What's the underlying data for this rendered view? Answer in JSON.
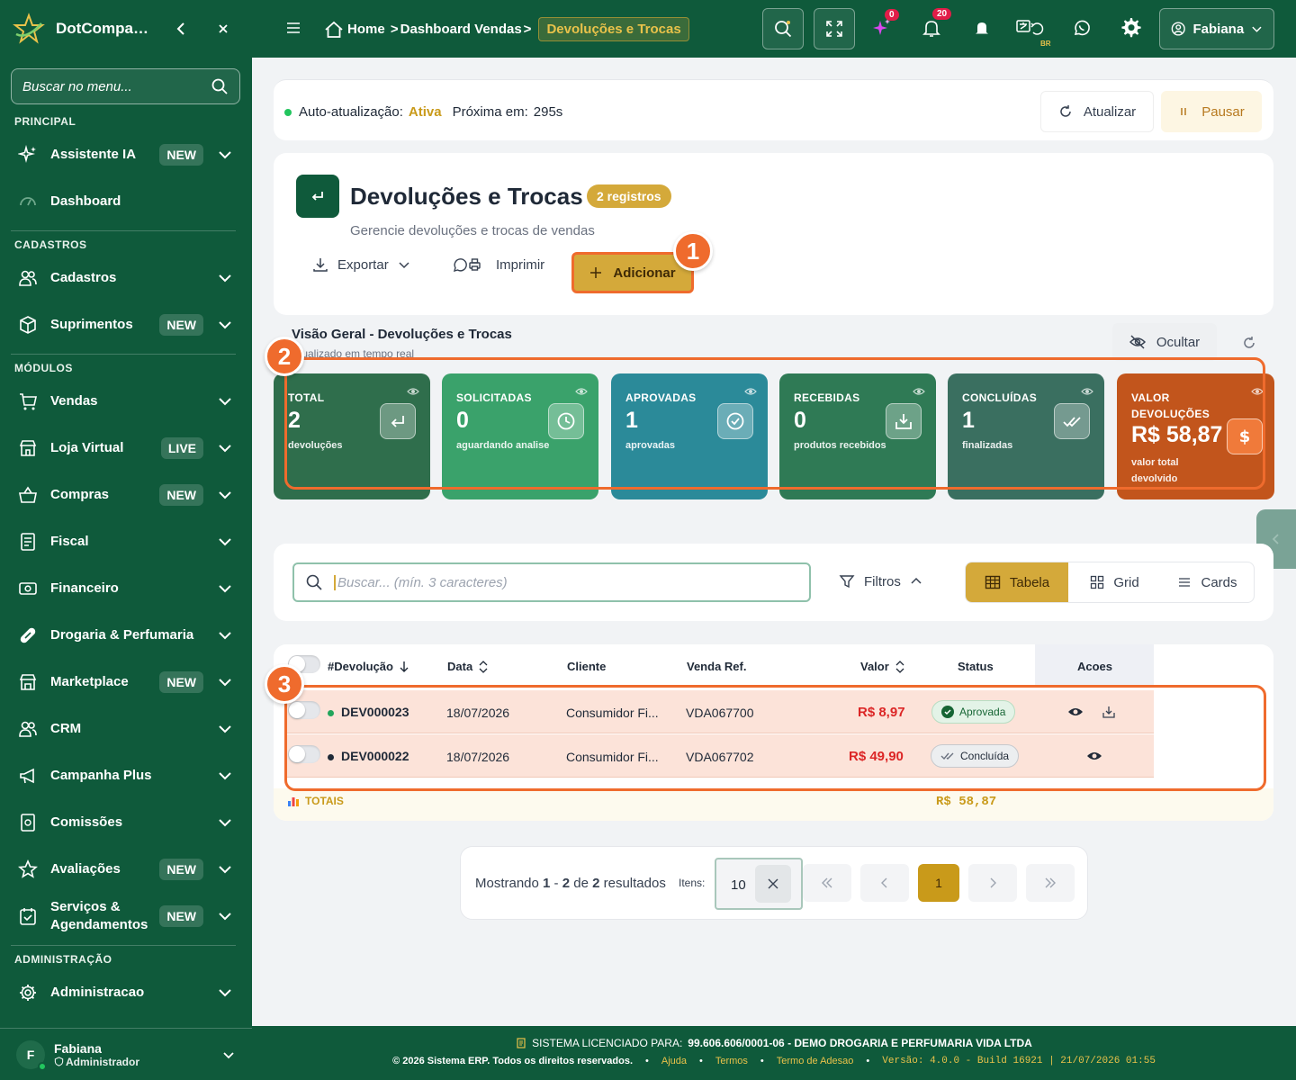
{
  "sidebar": {
    "brand": "DotCompanion",
    "search_placeholder": "Buscar no menu...",
    "sections": {
      "principal": "PRINCIPAL",
      "cadastros": "CADASTROS",
      "modulos": "MÓDULOS",
      "administracao": "ADMINISTRAÇÃO"
    },
    "items": [
      {
        "label": "Assistente IA",
        "badge": "NEW"
      },
      {
        "label": "Dashboard",
        "badge": ""
      },
      {
        "label": "Cadastros",
        "badge": ""
      },
      {
        "label": "Suprimentos",
        "badge": "NEW"
      },
      {
        "label": "Vendas",
        "badge": ""
      },
      {
        "label": "Loja Virtual",
        "badge": "LIVE"
      },
      {
        "label": "Compras",
        "badge": "NEW"
      },
      {
        "label": "Fiscal",
        "badge": ""
      },
      {
        "label": "Financeiro",
        "badge": ""
      },
      {
        "label": "Drogaria & Perfumaria",
        "badge": ""
      },
      {
        "label": "Marketplace",
        "badge": "NEW"
      },
      {
        "label": "CRM",
        "badge": ""
      },
      {
        "label": "Campanha Plus",
        "badge": ""
      },
      {
        "label": "Comissões",
        "badge": ""
      },
      {
        "label": "Avaliações",
        "badge": "NEW"
      },
      {
        "label": "Serviços & Agendamentos",
        "badge": "NEW"
      },
      {
        "label": "Administracao",
        "badge": ""
      }
    ],
    "user": {
      "initial": "F",
      "name": "Fabiana",
      "role": "Administrador"
    }
  },
  "topbar": {
    "breadcrumb": [
      "Home",
      "Dashboard Vendas",
      "Devoluções e Trocas"
    ],
    "ai_count": "0",
    "notif_count": "20",
    "locale": "BR",
    "user_name": "Fabiana"
  },
  "autorefresh": {
    "label": "Auto-atualização:",
    "state": "Ativa",
    "next_label": "Próxima em:",
    "next_value": "295s",
    "refresh_btn": "Atualizar",
    "pause_btn": "Pausar"
  },
  "header": {
    "title": "Devoluções e Trocas",
    "count": "2 registros",
    "subtitle": "Gerencie devoluções e trocas de vendas",
    "export": "Exportar",
    "print": "Imprimir",
    "add": "Adicionar"
  },
  "callouts": [
    "1",
    "2",
    "3"
  ],
  "overview": {
    "title": "Visão Geral - Devoluções e Trocas",
    "subtitle": "Atualizado em tempo real",
    "hide_btn": "Ocultar"
  },
  "stats": [
    {
      "label": "TOTAL",
      "value": "2",
      "desc": "devoluções",
      "color": "#2f6e4c"
    },
    {
      "label": "SOLICITADAS",
      "value": "0",
      "desc": "aguardando analise",
      "color": "#3aa26b"
    },
    {
      "label": "APROVADAS",
      "value": "1",
      "desc": "aprovadas",
      "color": "#2b8a99"
    },
    {
      "label": "RECEBIDAS",
      "value": "0",
      "desc": "produtos recebidos",
      "color": "#2f7a55"
    },
    {
      "label": "CONCLUÍDAS",
      "value": "1",
      "desc": "finalizadas",
      "color": "#3a6f60"
    },
    {
      "label": "VALOR DEVOLUÇÕES",
      "value": "R$ 58,87",
      "desc": "valor total devolvido",
      "color": "#c2551c"
    }
  ],
  "search": {
    "placeholder": "Buscar... (mín. 3 caracteres)",
    "filters": "Filtros",
    "views": [
      "Tabela",
      "Grid",
      "Cards"
    ]
  },
  "table": {
    "columns": [
      "#Devolução",
      "Data",
      "Cliente",
      "Venda Ref.",
      "Valor",
      "Status",
      "Acoes"
    ],
    "rows": [
      {
        "id": "DEV000023",
        "date": "18/07/2026",
        "client": "Consumidor Fi...",
        "sale": "VDA067700",
        "value": "R$ 8,97",
        "status": "Aprovada",
        "status_color": "#22a55b"
      },
      {
        "id": "DEV000022",
        "date": "18/07/2026",
        "client": "Consumidor Fi...",
        "sale": "VDA067702",
        "value": "R$ 49,90",
        "status": "Concluída",
        "status_color": "#1f2937"
      }
    ],
    "totals_label": "TOTAIS",
    "totals_value": "R$ 58,87"
  },
  "pagination": {
    "showing": "Mostrando",
    "from": "1",
    "to": "2",
    "of_word": "de",
    "total": "2",
    "results_word": "resultados",
    "items_label": "Itens:",
    "page_size": "10",
    "current_page": "1"
  },
  "footer": {
    "license_label": "SISTEMA LICENCIADO PARA:",
    "license_holder": "99.606.606/0001-06 - DEMO DROGARIA E PERFUMARIA VIDA LTDA",
    "copyright": "© 2026 Sistema ERP. Todos os direitos reservados.",
    "links": [
      "Ajuda",
      "Termos",
      "Termo de Adesao"
    ],
    "version": "Versão: 4.0.0 - Build 16921 | 21/07/2026 01:55"
  },
  "colors": {
    "brand_green": "#0f5a3b",
    "accent_gold": "#d4a93a",
    "highlight": "#ef6b2d"
  }
}
